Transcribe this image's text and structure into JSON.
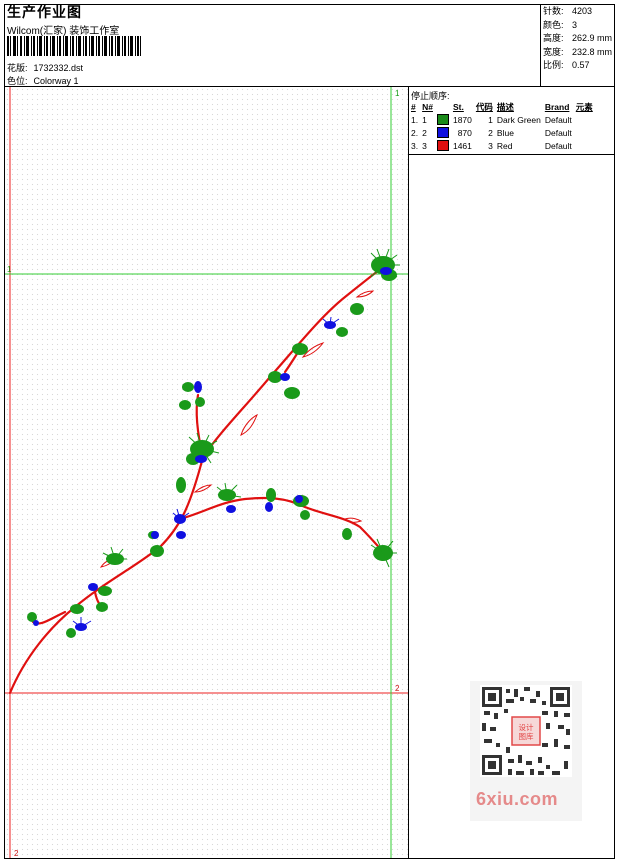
{
  "header": {
    "title": "生产作业图",
    "company": "Wilcom(汇家) 装饰工作室",
    "design_label": "花版:",
    "design_value": "1732332.dst",
    "colorway_label": "色位:",
    "colorway_value": "Colorway 1"
  },
  "stats": [
    {
      "label": "针数:",
      "value": "4203"
    },
    {
      "label": "颜色:",
      "value": "3"
    },
    {
      "label": "高度:",
      "value": "262.9 mm"
    },
    {
      "label": "宽度:",
      "value": "232.8 mm"
    },
    {
      "label": "比例:",
      "value": "0.57"
    }
  ],
  "stop_sequence": {
    "title": "停止顺序:",
    "columns": [
      "#",
      "N#",
      "St.",
      "代码",
      "描述",
      "Brand",
      "元素"
    ],
    "rows": [
      {
        "num": "1.",
        "n": "1",
        "color": "#1a8a1a",
        "stitches": "1870",
        "code": "1",
        "desc": "Dark Green",
        "brand": "Default"
      },
      {
        "num": "2.",
        "n": "2",
        "color": "#1010e0",
        "stitches": "870",
        "code": "2",
        "desc": "Blue",
        "brand": "Default"
      },
      {
        "num": "3.",
        "n": "3",
        "color": "#e01010",
        "stitches": "1461",
        "code": "3",
        "desc": "Red",
        "brand": "Default"
      }
    ]
  },
  "canvas": {
    "marker_top_right": "1",
    "marker_left_mid": "1",
    "marker_right_bottom": "2",
    "marker_bottom_left": "2"
  },
  "qr_badge": "设计图库",
  "watermark": "6xiu.com",
  "colors": {
    "guide_green": "#33cc33",
    "guide_red": "#ee2222",
    "stem_red": "#e01010",
    "leaf_green": "#1a9a1a",
    "flower_blue": "#1010e0"
  }
}
